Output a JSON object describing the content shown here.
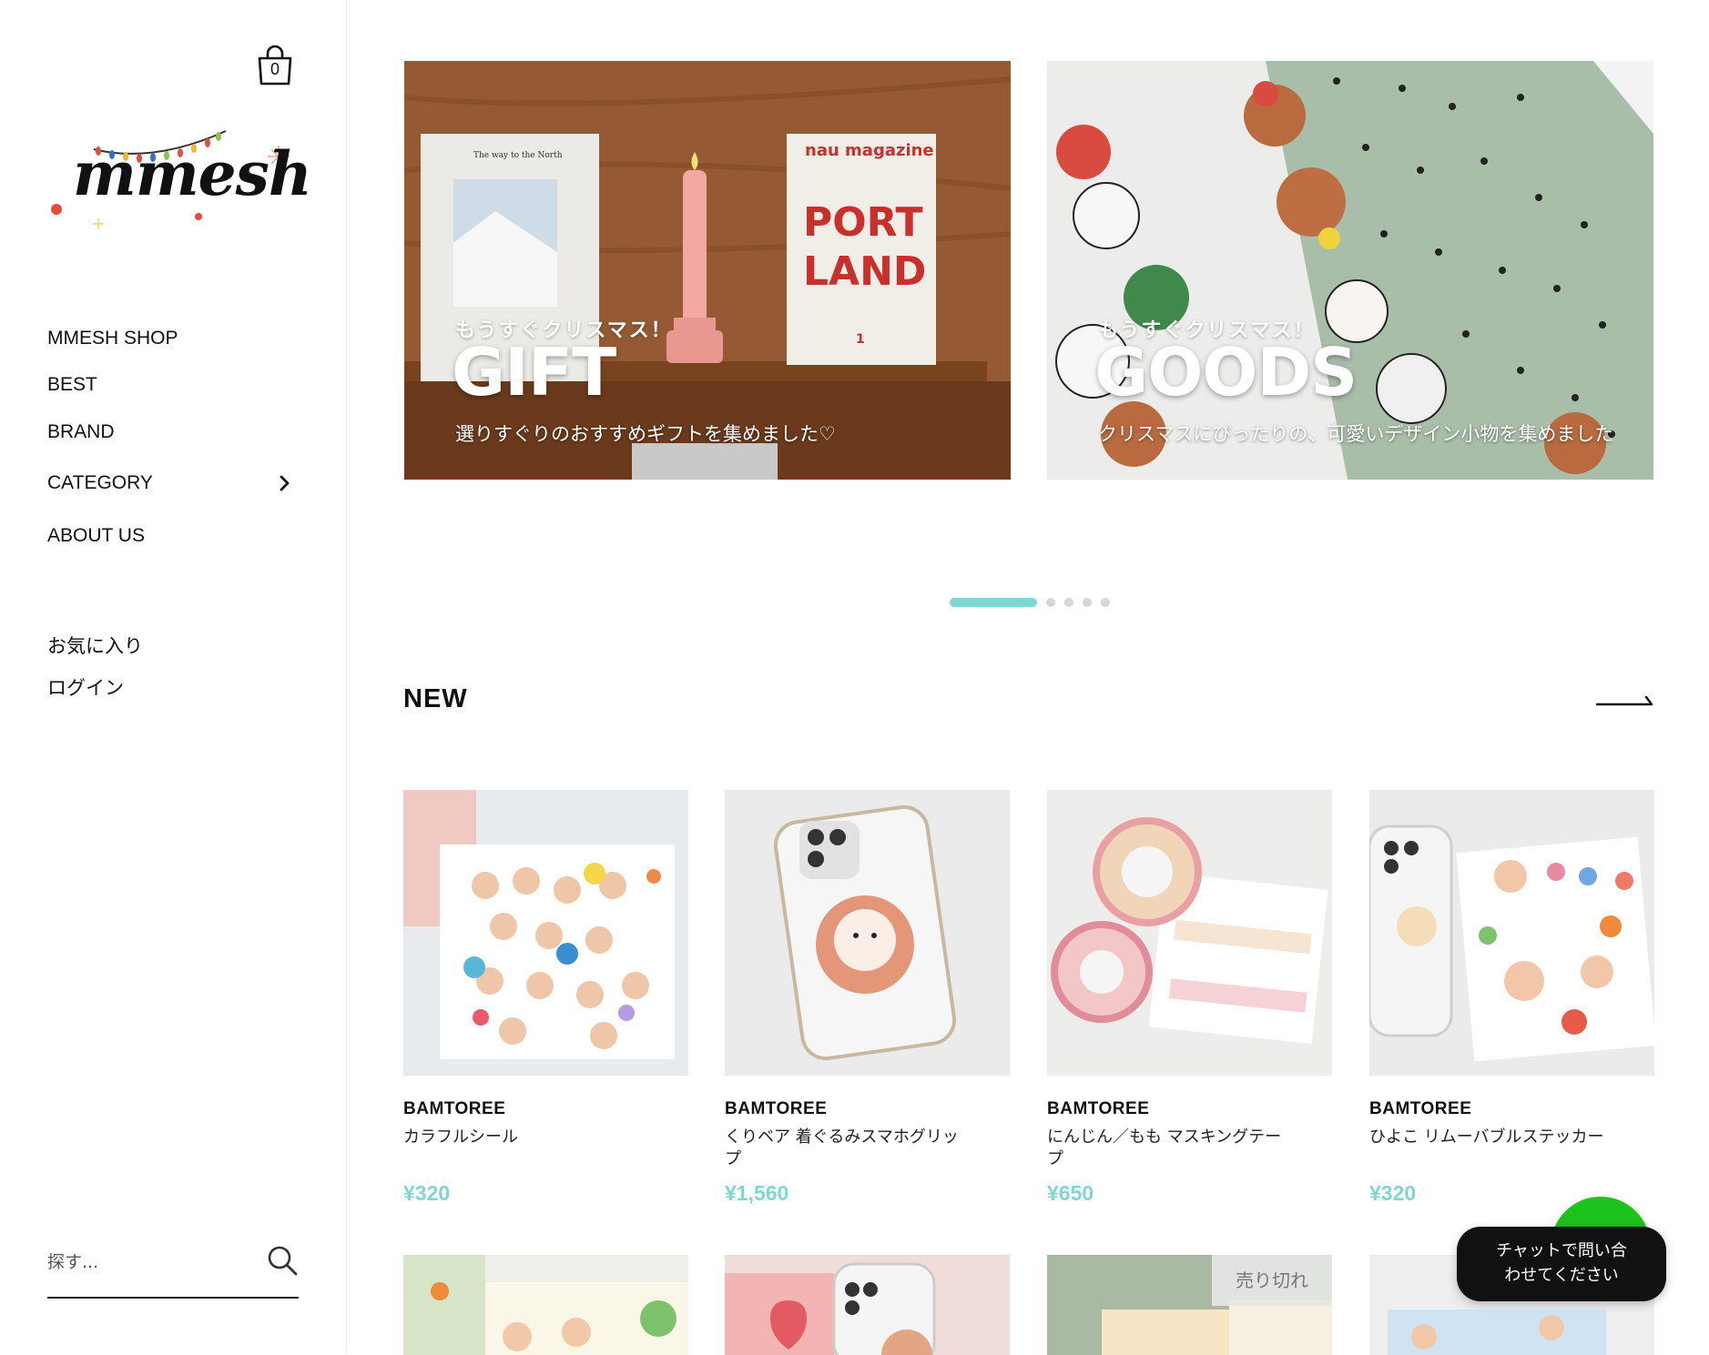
{
  "sidebar": {
    "cart_count": "0",
    "logo_text": "mmesh",
    "nav": [
      {
        "label": "MMESH SHOP"
      },
      {
        "label": "BEST"
      },
      {
        "label": "BRAND"
      },
      {
        "label": "CATEGORY"
      },
      {
        "label": "ABOUT US"
      }
    ],
    "account": [
      {
        "label": "お気に入り"
      },
      {
        "label": "ログイン"
      }
    ],
    "search_placeholder": "探す..."
  },
  "banners": [
    {
      "kicker": "もうすぐクリスマス！",
      "title": "GIFT",
      "description": "選りすぐりのおすすめギフトを集めました♡",
      "book_left_title": "The way to the North",
      "book_right_header": "nau magazine",
      "book_right_title_1": "PORT",
      "book_right_title_2": "LAND",
      "book_right_number": "1"
    },
    {
      "kicker": "もうすぐクリスマス！",
      "title": "GOODS",
      "description": "クリスマスにぴったりの、可愛いデザイン小物を集めました"
    }
  ],
  "carousel": {
    "count": 5,
    "active_index": 0
  },
  "section": {
    "title": "NEW"
  },
  "products": [
    {
      "brand": "BAMTOREE",
      "name": "カラフルシール",
      "price": "¥320"
    },
    {
      "brand": "BAMTOREE",
      "name": "くりベア 着ぐるみスマホグリップ",
      "price": "¥1,560"
    },
    {
      "brand": "BAMTOREE",
      "name": "にんじん／もも マスキングテープ",
      "price": "¥650"
    },
    {
      "brand": "BAMTOREE",
      "name": "ひよこ リムーバブルステッカー",
      "price": "¥320"
    }
  ],
  "products_row2": [
    {
      "badge": ""
    },
    {
      "badge": ""
    },
    {
      "badge": "売り切れ"
    },
    {
      "badge": ""
    }
  ],
  "chat": {
    "label_line1": "チャットで問い合",
    "label_line2": "わせてください"
  },
  "colors": {
    "accent": "#7fd6d2",
    "text": "#111111",
    "chat_bg": "#111111",
    "chat_green": "#1dc31d"
  }
}
